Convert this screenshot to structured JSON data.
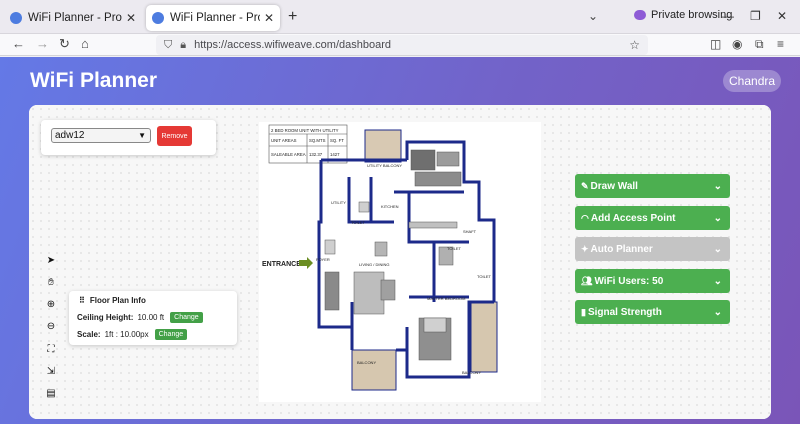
{
  "browser": {
    "tabs": [
      {
        "title": "WiFi Planner - Professional WiFi",
        "close": "✕"
      },
      {
        "title": "WiFi Planner - Professional WiFi",
        "close": "✕"
      }
    ],
    "new_tab": "+",
    "private_label": "Private browsing",
    "url": "https://access.wifiweave.com/dashboard"
  },
  "app": {
    "title": "WiFi Planner",
    "user": "Chandra"
  },
  "floor": {
    "selected": "adw12",
    "remove_label": "Remove"
  },
  "tools": [
    "pointer-icon",
    "hand-icon",
    "zoom-in-icon",
    "zoom-out-icon",
    "fit-screen-icon",
    "export-icon",
    "document-icon"
  ],
  "info": {
    "title": "Floor Plan Info",
    "ceiling_label": "Ceiling Height:",
    "ceiling_value": "10.00 ft",
    "scale_label": "Scale:",
    "scale_value": "1ft : 10.00px",
    "change_label": "Change"
  },
  "plan": {
    "table_header": "2 BED ROOM UNIT WITH UTILITY",
    "col_areas": "UNIT AREAS",
    "col_sqm": "SQ.MTS",
    "col_sqft": "SQ. FT",
    "row_label": "SALEABLE AREA",
    "row_sqm": "132.37",
    "row_sqft": "1427",
    "entrance": "ENTRANCE",
    "rooms": {
      "utility_balcony": "UTILITY BALCONY",
      "utility": "UTILITY",
      "kitchen": "KITCHEN",
      "toilet1": "TOILET",
      "toilet2": "TOILET",
      "toilet3": "TOILET",
      "foyer": "FOYER",
      "living": "LIVING / DINING",
      "master": "MASTER BEDROOM",
      "balcony1": "BALCONY",
      "balcony2": "BALCONY",
      "shaft": "SHAFT"
    }
  },
  "panels": [
    {
      "label": "Draw Wall",
      "icon": "pencil-icon"
    },
    {
      "label": "Add Access Point",
      "icon": "wifi-icon"
    },
    {
      "label": "Auto Planner",
      "icon": "magic-icon"
    },
    {
      "label": "WiFi Users: 50",
      "icon": "users-icon"
    },
    {
      "label": "Signal Strength",
      "icon": "signal-icon"
    }
  ],
  "colors": {
    "accent_green": "#4caf50",
    "remove_red": "#e53935",
    "header_gradient": "#6479e6",
    "wall_blue": "#1c2a8a"
  }
}
